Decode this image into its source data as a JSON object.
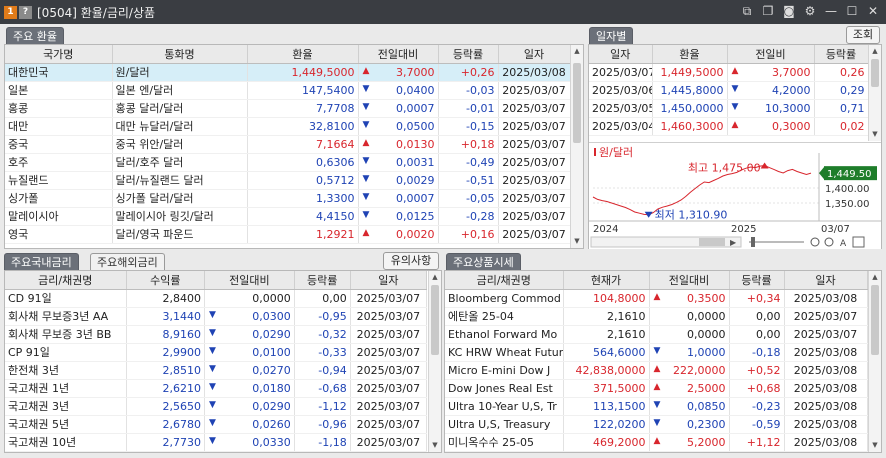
{
  "window": {
    "badge1": "1",
    "badge2": "?",
    "title": "[0504] 환율/금리/상품"
  },
  "fx": {
    "tab": "주요 환율",
    "headers": [
      "국가명",
      "통화명",
      "환율",
      "전일대비",
      "등락률",
      "일자"
    ],
    "rows": [
      [
        "대한민국",
        "원/달러",
        "1,449,5000",
        "up",
        "3,7000",
        "+0,26",
        "2025/03/08"
      ],
      [
        "일본",
        "일본 엔/달러",
        "147,5400",
        "down",
        "0,0400",
        "-0,03",
        "2025/03/07"
      ],
      [
        "홍콩",
        "홍콩 달러/달러",
        "7,7708",
        "down",
        "0,0007",
        "-0,01",
        "2025/03/07"
      ],
      [
        "대만",
        "대만 뉴달러/달러",
        "32,8100",
        "down",
        "0,0500",
        "-0,15",
        "2025/03/07"
      ],
      [
        "중국",
        "중국 위안/달러",
        "7,1664",
        "up",
        "0,0130",
        "+0,18",
        "2025/03/07"
      ],
      [
        "호주",
        "달러/호주 달러",
        "0,6306",
        "down",
        "0,0031",
        "-0,49",
        "2025/03/07"
      ],
      [
        "뉴질랜드",
        "달러/뉴질랜드 달러",
        "0,5712",
        "down",
        "0,0029",
        "-0,51",
        "2025/03/07"
      ],
      [
        "싱가폴",
        "싱가폴 달러/달러",
        "1,3300",
        "down",
        "0,0007",
        "-0,05",
        "2025/03/07"
      ],
      [
        "말레이시아",
        "말레이시아 링깃/달러",
        "4,4150",
        "down",
        "0,0125",
        "-0,28",
        "2025/03/07"
      ],
      [
        "영국",
        "달러/영국 파운드",
        "1,2921",
        "up",
        "0,0020",
        "+0,16",
        "2025/03/07"
      ]
    ]
  },
  "daily": {
    "tab": "일자별",
    "button": "조회",
    "headers": [
      "일자",
      "환율",
      "전일비",
      "등락률"
    ],
    "rows": [
      [
        "2025/03/07",
        "1,449,5000",
        "up",
        "3,7000",
        "0,26"
      ],
      [
        "2025/03/06",
        "1,445,8000",
        "down",
        "4,2000",
        "0,29"
      ],
      [
        "2025/03/05",
        "1,450,0000",
        "down",
        "10,3000",
        "0,71"
      ],
      [
        "2025/03/04",
        "1,460,3000",
        "up",
        "0,3000",
        "0,02"
      ]
    ]
  },
  "chart_data": {
    "type": "line",
    "series_label": "원/달러",
    "high_label": "최고 1,475.00",
    "low_label": "최저 1,310.90",
    "current_label": "1,449.50",
    "yticks": [
      "1,400.00",
      "1,350.00"
    ],
    "xticks": [
      "2024",
      "2025",
      "03/07"
    ],
    "y_range": [
      1290,
      1490
    ],
    "y_tick_values": [
      1400,
      1350
    ],
    "high": 1475.0,
    "low": 1310.9,
    "current": 1449.5,
    "values": [
      1370,
      1362,
      1358,
      1355,
      1350,
      1345,
      1340,
      1335,
      1328,
      1320,
      1316,
      1312,
      1311,
      1318,
      1330,
      1336,
      1340,
      1345,
      1352,
      1360,
      1372,
      1386,
      1398,
      1410,
      1420,
      1418,
      1425,
      1432,
      1440,
      1445,
      1448,
      1452,
      1460,
      1466,
      1470,
      1468,
      1473,
      1475,
      1468,
      1462,
      1455,
      1450,
      1458,
      1462,
      1455,
      1450,
      1445,
      1449.5
    ]
  },
  "domestic": {
    "tab_active": "주요국내금리",
    "tab_inactive": "주요해외금리",
    "button": "유의사항",
    "headers": [
      "금리/채권명",
      "수익률",
      "전일대비",
      "등락률",
      "일자"
    ],
    "rows": [
      [
        "CD 91일",
        "2,8400",
        "flat",
        "0,0000",
        "0,00",
        "2025/03/07"
      ],
      [
        "회사채 무보증3년 AA",
        "3,1440",
        "down",
        "0,0300",
        "-0,95",
        "2025/03/07"
      ],
      [
        "회사채 무보증 3년 BB",
        "8,9160",
        "down",
        "0,0290",
        "-0,32",
        "2025/03/07"
      ],
      [
        "CP 91일",
        "2,9900",
        "down",
        "0,0100",
        "-0,33",
        "2025/03/07"
      ],
      [
        "한전채 3년",
        "2,8510",
        "down",
        "0,0270",
        "-0,94",
        "2025/03/07"
      ],
      [
        "국고채권 1년",
        "2,6210",
        "down",
        "0,0180",
        "-0,68",
        "2025/03/07"
      ],
      [
        "국고채권 3년",
        "2,5650",
        "down",
        "0,0290",
        "-1,12",
        "2025/03/07"
      ],
      [
        "국고채권 5년",
        "2,6780",
        "down",
        "0,0260",
        "-0,96",
        "2025/03/07"
      ],
      [
        "국고채권 10년",
        "2,7730",
        "down",
        "0,0330",
        "-1,18",
        "2025/03/07"
      ]
    ]
  },
  "commodity": {
    "tab": "주요상품시세",
    "headers": [
      "금리/채권명",
      "현재가",
      "전일대비",
      "등락률",
      "일자"
    ],
    "rows": [
      [
        "Bloomberg Commod",
        "104,8000",
        "up",
        "0,3500",
        "+0,34",
        "2025/03/08"
      ],
      [
        "에탄올 25-04",
        "2,1610",
        "flat",
        "0,0000",
        "0,00",
        "2025/03/07"
      ],
      [
        "Ethanol Forward Mo",
        "2,1610",
        "flat",
        "0,0000",
        "0,00",
        "2025/03/07"
      ],
      [
        "KC HRW Wheat Futur",
        "564,6000",
        "down",
        "1,0000",
        "-0,18",
        "2025/03/08"
      ],
      [
        "Micro E-mini Dow J",
        "42,838,0000",
        "up",
        "222,0000",
        "+0,52",
        "2025/03/08"
      ],
      [
        "Dow Jones Real Est",
        "371,5000",
        "up",
        "2,5000",
        "+0,68",
        "2025/03/08"
      ],
      [
        "Ultra 10-Year U,S, Tr",
        "113,1500",
        "down",
        "0,0850",
        "-0,23",
        "2025/03/08"
      ],
      [
        "Ultra U,S, Treasury",
        "122,0200",
        "down",
        "0,2300",
        "-0,59",
        "2025/03/08"
      ],
      [
        "미니옥수수 25-05",
        "469,2000",
        "up",
        "5,2000",
        "+1,12",
        "2025/03/08"
      ]
    ]
  },
  "colors": {
    "up": "#d8262d",
    "down": "#1f43b4",
    "line": "#d8262d",
    "current_bg": "#1e7d2a",
    "titlebar": "#3a3d42",
    "tab_active": "#6b7079"
  }
}
